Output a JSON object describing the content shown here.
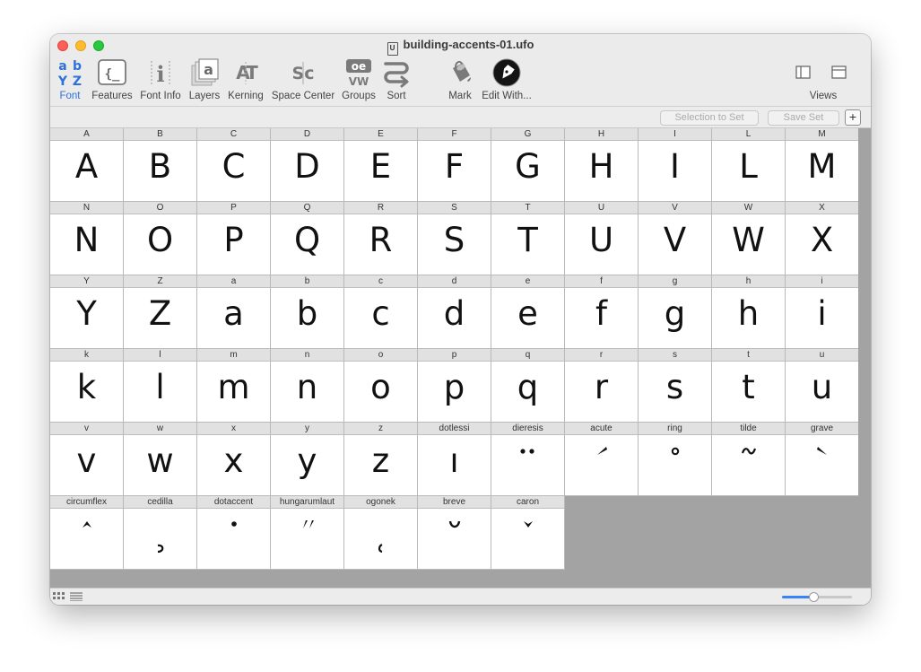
{
  "window": {
    "title": "building-accents-01.ufo",
    "doc_icon": "U"
  },
  "toolbar": {
    "items": [
      {
        "name": "font",
        "label": "Font",
        "icon": "font-grid-icon",
        "active": true
      },
      {
        "name": "features",
        "label": "Features",
        "icon": "features-icon"
      },
      {
        "name": "font-info",
        "label": "Font Info",
        "icon": "font-info-icon"
      },
      {
        "name": "layers",
        "label": "Layers",
        "icon": "layers-icon"
      },
      {
        "name": "kerning",
        "label": "Kerning",
        "icon": "kerning-icon"
      },
      {
        "name": "space-center",
        "label": "Space Center",
        "icon": "space-center-icon"
      },
      {
        "name": "groups",
        "label": "Groups",
        "icon": "groups-icon"
      },
      {
        "name": "sort",
        "label": "Sort",
        "icon": "sort-icon"
      },
      {
        "name": "mark",
        "label": "Mark",
        "icon": "paint-bucket-icon"
      },
      {
        "name": "edit-with",
        "label": "Edit With...",
        "icon": "pen-nib-icon"
      },
      {
        "name": "views",
        "label": "Views",
        "icon": "views-icon"
      }
    ],
    "icon_text": {
      "font": [
        "a",
        "b",
        "Y",
        "Z"
      ],
      "features": "{_",
      "font_info": "i",
      "layers": "a",
      "kerning": "AT",
      "space_center": "Sc",
      "groups": [
        "oe",
        "VW"
      ]
    }
  },
  "subbar": {
    "selection_to_set": "Selection to Set",
    "save_set": "Save Set",
    "add": "+"
  },
  "glyphs": [
    {
      "name": "A",
      "char": "A"
    },
    {
      "name": "B",
      "char": "B"
    },
    {
      "name": "C",
      "char": "C"
    },
    {
      "name": "D",
      "char": "D"
    },
    {
      "name": "E",
      "char": "E"
    },
    {
      "name": "F",
      "char": "F"
    },
    {
      "name": "G",
      "char": "G"
    },
    {
      "name": "H",
      "char": "H"
    },
    {
      "name": "I",
      "char": "I"
    },
    {
      "name": "L",
      "char": "L"
    },
    {
      "name": "M",
      "char": "M"
    },
    {
      "name": "N",
      "char": "N"
    },
    {
      "name": "O",
      "char": "O"
    },
    {
      "name": "P",
      "char": "P"
    },
    {
      "name": "Q",
      "char": "Q"
    },
    {
      "name": "R",
      "char": "R"
    },
    {
      "name": "S",
      "char": "S"
    },
    {
      "name": "T",
      "char": "T"
    },
    {
      "name": "U",
      "char": "U"
    },
    {
      "name": "V",
      "char": "V"
    },
    {
      "name": "W",
      "char": "W"
    },
    {
      "name": "X",
      "char": "X"
    },
    {
      "name": "Y",
      "char": "Y"
    },
    {
      "name": "Z",
      "char": "Z"
    },
    {
      "name": "a",
      "char": "a"
    },
    {
      "name": "b",
      "char": "b"
    },
    {
      "name": "c",
      "char": "c"
    },
    {
      "name": "d",
      "char": "d"
    },
    {
      "name": "e",
      "char": "e"
    },
    {
      "name": "f",
      "char": "f"
    },
    {
      "name": "g",
      "char": "g"
    },
    {
      "name": "h",
      "char": "h"
    },
    {
      "name": "i",
      "char": "i"
    },
    {
      "name": "k",
      "char": "k"
    },
    {
      "name": "l",
      "char": "l"
    },
    {
      "name": "m",
      "char": "m"
    },
    {
      "name": "n",
      "char": "n"
    },
    {
      "name": "o",
      "char": "o"
    },
    {
      "name": "p",
      "char": "p"
    },
    {
      "name": "q",
      "char": "q"
    },
    {
      "name": "r",
      "char": "r"
    },
    {
      "name": "s",
      "char": "s"
    },
    {
      "name": "t",
      "char": "t"
    },
    {
      "name": "u",
      "char": "u"
    },
    {
      "name": "v",
      "char": "v"
    },
    {
      "name": "w",
      "char": "w"
    },
    {
      "name": "x",
      "char": "x"
    },
    {
      "name": "y",
      "char": "y"
    },
    {
      "name": "z",
      "char": "z"
    },
    {
      "name": "dotlessi",
      "char": "ı"
    },
    {
      "name": "dieresis",
      "mark": "dieresis"
    },
    {
      "name": "acute",
      "mark": "acute"
    },
    {
      "name": "ring",
      "mark": "ring"
    },
    {
      "name": "tilde",
      "mark": "tilde"
    },
    {
      "name": "grave",
      "mark": "grave"
    },
    {
      "name": "circumflex",
      "mark": "circumflex"
    },
    {
      "name": "cedilla",
      "mark": "cedilla"
    },
    {
      "name": "dotaccent",
      "mark": "dotaccent"
    },
    {
      "name": "hungarumlaut",
      "mark": "hungarumlaut"
    },
    {
      "name": "ogonek",
      "mark": "ogonek"
    },
    {
      "name": "breve",
      "mark": "breve"
    },
    {
      "name": "caron",
      "mark": "caron"
    }
  ],
  "statusbar": {
    "grid_view_icon": "grid-view-icon",
    "list_view_icon": "list-view-icon",
    "zoom_level": 0.45
  },
  "colors": {
    "accent": "#3b82f6",
    "active_label": "#2d72d9",
    "empty_area": "#a3a3a3"
  }
}
